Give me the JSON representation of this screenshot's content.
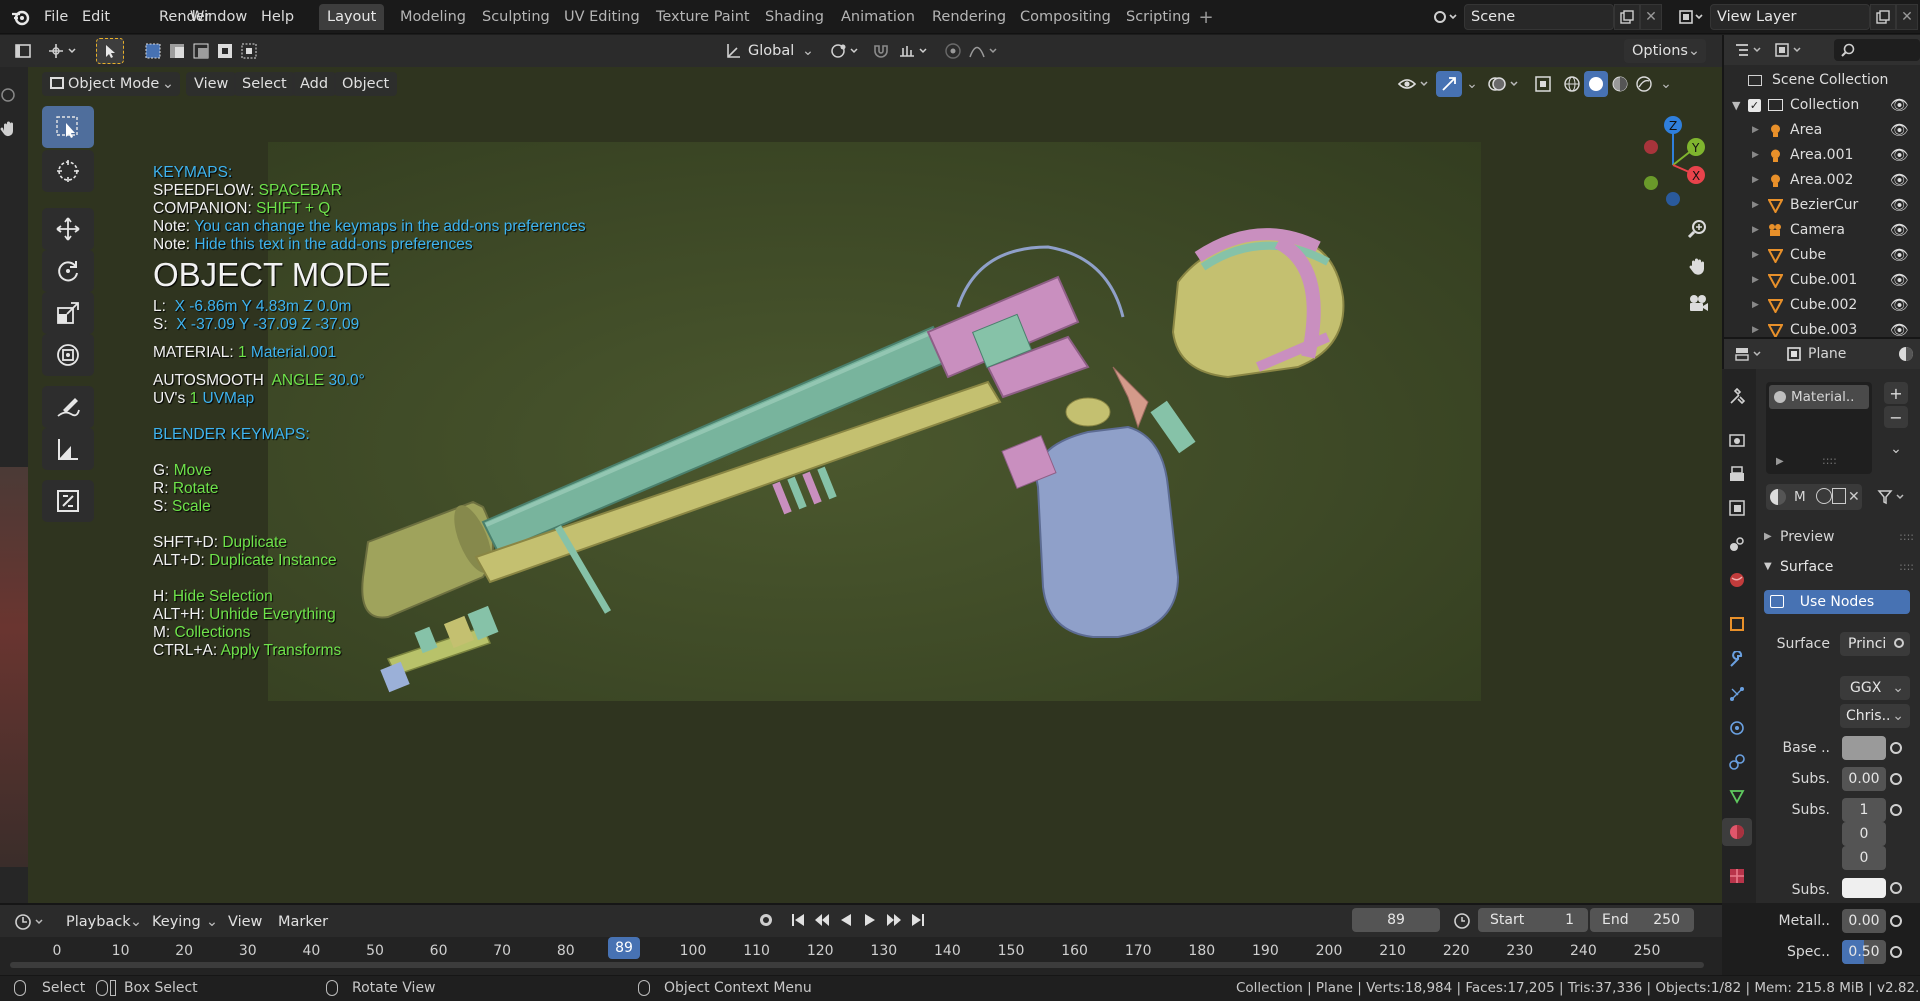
{
  "menus": [
    "File",
    "Edit",
    "Render",
    "Window",
    "Help"
  ],
  "workspaces": [
    "Layout",
    "Modeling",
    "Sculpting",
    "UV Editing",
    "Texture Paint",
    "Shading",
    "Animation",
    "Rendering",
    "Compositing",
    "Scripting"
  ],
  "scene": {
    "label": "Scene",
    "view_layer": "View Layer"
  },
  "viewport_header": {
    "mode": "Object Mode",
    "menus": [
      "View",
      "Select",
      "Add",
      "Object"
    ],
    "orientation": "Global",
    "options": "Options"
  },
  "overlay": {
    "keymaps_title": "KEYMAPS:",
    "speedflow_label": "SPEEDFLOW:",
    "speedflow_key": "SPACEBAR",
    "companion_label": "COMPANION:",
    "companion_key": "SHIFT + Q",
    "note_label": "Note:",
    "note1": "You can change the keymaps in the add-ons preferences",
    "note2": "Hide this text in the add-ons preferences",
    "mode_title": "OBJECT MODE",
    "loc_label": "L:",
    "loc": "X -6.86m Y 4.83m Z 0.0m",
    "scale_label": "S:",
    "scale": "X -37.09 Y -37.09 Z -37.09",
    "material_label": "MATERIAL:",
    "material_count": "1",
    "material_name": "Material.001",
    "autosmooth_label": "AUTOSMOOTH",
    "angle_label": "ANGLE",
    "angle_value": "30.0°",
    "uvs_label": "UV's",
    "uvs_count": "1",
    "uvs_name": "UVMap",
    "blender_keymaps_title": "BLENDER KEYMAPS:",
    "keys": [
      {
        "k": "G:",
        "v": "Move"
      },
      {
        "k": "R:",
        "v": "Rotate"
      },
      {
        "k": "S:",
        "v": "Scale"
      },
      {
        "k": "SHFT+D:",
        "v": "Duplicate"
      },
      {
        "k": "ALT+D:",
        "v": "Duplicate Instance"
      },
      {
        "k": "H:",
        "v": "Hide Selection"
      },
      {
        "k": "ALT+H:",
        "v": "Unhide Everything"
      },
      {
        "k": "M:",
        "v": "Collections"
      },
      {
        "k": "CTRL+A:",
        "v": "Apply Transforms"
      }
    ]
  },
  "gizmo": {
    "z": "Z",
    "y": "Y",
    "x": "X"
  },
  "outliner": {
    "root": "Scene Collection",
    "collection": "Collection",
    "items": [
      "Area",
      "Area.001",
      "Area.002",
      "BezierCur",
      "Camera",
      "Cube",
      "Cube.001",
      "Cube.002",
      "Cube.003"
    ]
  },
  "properties": {
    "object": "Plane",
    "material_slot": "Material..",
    "m_label": "M",
    "preview": "Preview",
    "surface_panel": "Surface",
    "use_nodes": "Use Nodes",
    "surface_label": "Surface",
    "surface_value": "Princi",
    "ggx": "GGX",
    "chris": "Chris..",
    "base_label": "Base ..",
    "subs1_label": "Subs.",
    "subs1_value": "0.00",
    "subs2_label": "Subs.",
    "subs2_values": [
      "1",
      "0",
      "0"
    ],
    "subs3_label": "Subs.",
    "metal_label": "Metall..",
    "metal_value": "0.00",
    "spec_label": "Spec..",
    "spec_value": "0.50",
    "spec_fraction": 0.5
  },
  "timeline": {
    "menus": [
      "Playback",
      "Keying",
      "View",
      "Marker"
    ],
    "current_frame": "89",
    "start_label": "Start",
    "start": "1",
    "end_label": "End",
    "end": "250",
    "ticks": [
      "0",
      "10",
      "20",
      "30",
      "40",
      "50",
      "60",
      "70",
      "80",
      "89",
      "100",
      "110",
      "120",
      "130",
      "140",
      "150",
      "160",
      "170",
      "180",
      "190",
      "200",
      "210",
      "220",
      "230",
      "240",
      "250"
    ]
  },
  "statusbar": {
    "select": "Select",
    "box_select": "Box Select",
    "rotate_view": "Rotate View",
    "context_menu": "Object Context Menu",
    "stats": "Collection | Plane | Verts:18,984 | Faces:17,205 | Tris:37,336 | Objects:1/82 | Mem: 215.8 MiB | v2.82.7"
  },
  "colors": {
    "accent": "#4772b3",
    "active_tool": "#4f6e9c",
    "note_blue": "#3fb4f0",
    "value_green": "#6fe34b"
  }
}
